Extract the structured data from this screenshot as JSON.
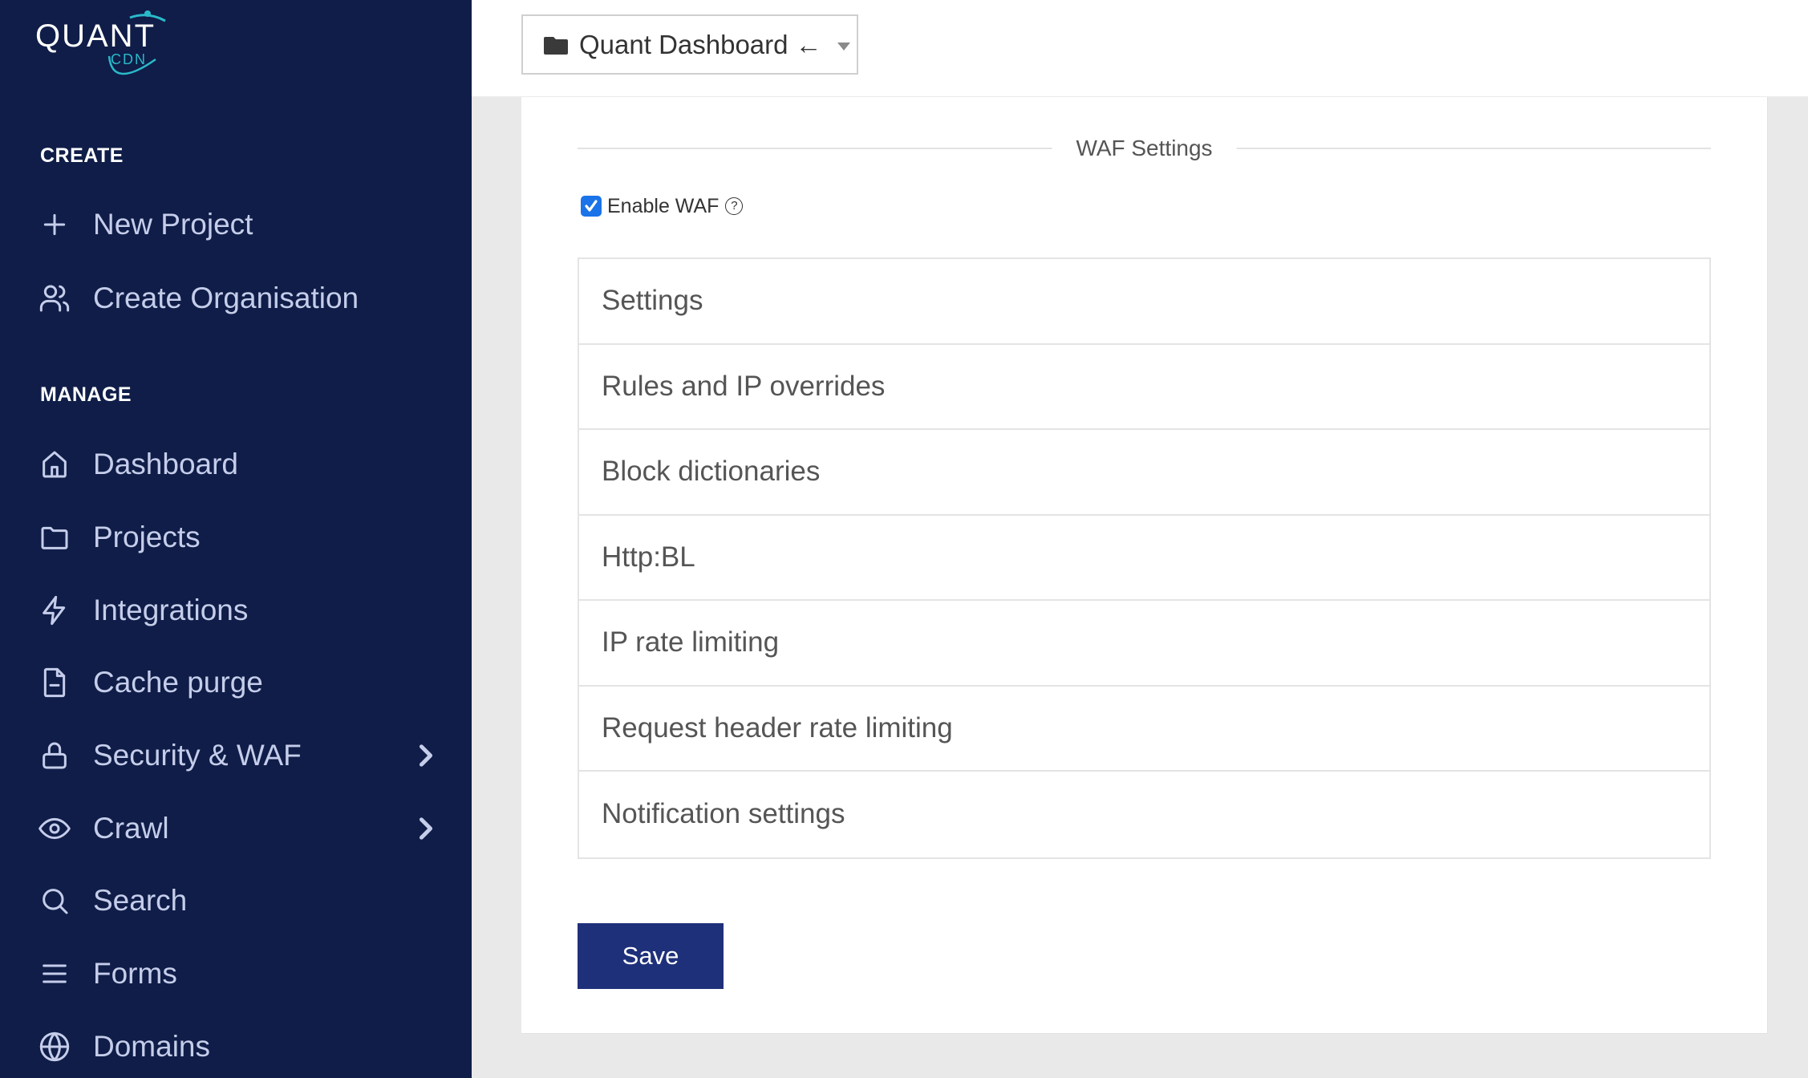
{
  "brand": {
    "name": "QUANT",
    "sub": "CDN",
    "colors": {
      "sidebar": "#0f1d48",
      "accent": "#2bb9c9",
      "button": "#1f307a",
      "checkbox": "#1a73e8"
    }
  },
  "sidebar": {
    "create_title": "CREATE",
    "create_items": [
      {
        "label": "New Project",
        "icon": "plus-icon"
      },
      {
        "label": "Create Organisation",
        "icon": "users-icon"
      }
    ],
    "manage_title": "MANAGE",
    "manage_items": [
      {
        "label": "Dashboard",
        "icon": "home-icon",
        "has_submenu": false
      },
      {
        "label": "Projects",
        "icon": "folder-icon",
        "has_submenu": false
      },
      {
        "label": "Integrations",
        "icon": "lightning-icon",
        "has_submenu": false
      },
      {
        "label": "Cache purge",
        "icon": "file-minus-icon",
        "has_submenu": false
      },
      {
        "label": "Security & WAF",
        "icon": "lock-icon",
        "has_submenu": true
      },
      {
        "label": "Crawl",
        "icon": "eye-icon",
        "has_submenu": true
      },
      {
        "label": "Search",
        "icon": "search-icon",
        "has_submenu": false
      },
      {
        "label": "Forms",
        "icon": "menu-lines-icon",
        "has_submenu": false
      },
      {
        "label": "Domains",
        "icon": "globe-icon",
        "has_submenu": false
      }
    ]
  },
  "header": {
    "project_selector": {
      "value": "Quant Dashboard ←",
      "icon": "folder-solid-icon"
    }
  },
  "waf": {
    "section_title": "WAF Settings",
    "enable_label": "Enable WAF",
    "enable_checked": true,
    "help_symbol": "?",
    "panels": [
      "Settings",
      "Rules and IP overrides",
      "Block dictionaries",
      "Http:BL",
      "IP rate limiting",
      "Request header rate limiting",
      "Notification settings"
    ],
    "save_label": "Save"
  }
}
